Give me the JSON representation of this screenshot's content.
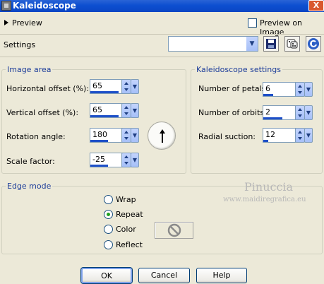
{
  "window": {
    "title": "Kaleidoscope",
    "close_glyph": "X",
    "icon": "app-icon"
  },
  "preview": {
    "label": "Preview",
    "preview_on_image_label": "Preview on Image",
    "preview_on_image_checked": false
  },
  "settings": {
    "label": "Settings",
    "value": "",
    "icons": [
      "save-icon",
      "dice-icon",
      "reset-icon"
    ]
  },
  "image_area": {
    "title": "Image area",
    "horizontal_offset": {
      "label": "Horizontal offset (%):",
      "value": "65",
      "level": 0.825
    },
    "vertical_offset": {
      "label": "Vertical offset (%):",
      "value": "65",
      "level": 0.825
    },
    "rotation_angle": {
      "label": "Rotation angle:",
      "value": "180",
      "level": 0.5
    },
    "scale_factor": {
      "label": "Scale factor:",
      "value": "-25",
      "level": 0.5
    }
  },
  "kaleidoscope_settings": {
    "title": "Kaleidoscope settings",
    "petals": {
      "label": "Number of petals:",
      "value": "6",
      "level": 0.3
    },
    "orbits": {
      "label": "Number of orbits:",
      "value": "2",
      "level": 0.6
    },
    "radial_suction": {
      "label": "Radial suction:",
      "value": "12",
      "level": 0.15
    }
  },
  "edge_mode": {
    "title": "Edge mode",
    "options": [
      {
        "label": "Wrap",
        "selected": false
      },
      {
        "label": "Repeat",
        "selected": true
      },
      {
        "label": "Color",
        "selected": false
      },
      {
        "label": "Reflect",
        "selected": false
      }
    ]
  },
  "watermark": {
    "line1": "Pinuccia",
    "line2": "www.maidiregrafica.eu"
  },
  "buttons": {
    "ok": "OK",
    "cancel": "Cancel",
    "help": "Help"
  },
  "colors": {
    "titlebar": "#0a46c4",
    "group_title": "#1e3e9a",
    "slider_fill": "#1e50c8",
    "radio_dot": "#21a121"
  }
}
